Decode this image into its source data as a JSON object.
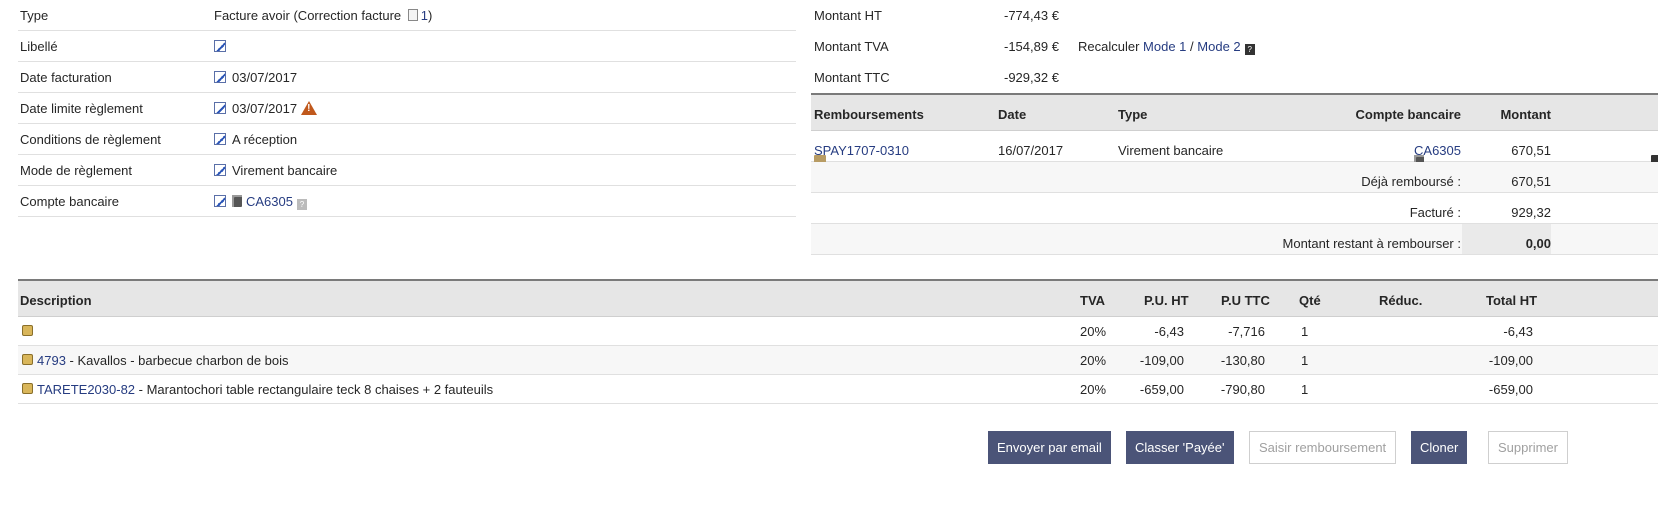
{
  "left_rows": [
    {
      "label": "Type",
      "value_pre": "Facture avoir (Correction facture ",
      "value_link": "1",
      "value_post": ")"
    },
    {
      "label": "Libellé",
      "value": ""
    },
    {
      "label": "Date facturation",
      "value": "03/07/2017"
    },
    {
      "label": "Date limite règlement",
      "value": "03/07/2017"
    },
    {
      "label": "Conditions de règlement",
      "value": "A réception"
    },
    {
      "label": "Mode de règlement",
      "value": "Virement bancaire"
    },
    {
      "label": "Compte bancaire",
      "value": "CA6305"
    }
  ],
  "summary": {
    "ht_label": "Montant HT",
    "ht_value": "-774,43 €",
    "tva_label": "Montant TVA",
    "tva_value": "-154,89 €",
    "recalc_label": "Recalculer",
    "mode1": "Mode 1",
    "sep": "/",
    "mode2": "Mode 2",
    "ttc_label": "Montant TTC",
    "ttc_value": "-929,32 €"
  },
  "payments": {
    "headers": {
      "ref": "Remboursements",
      "date": "Date",
      "type": "Type",
      "account": "Compte bancaire",
      "amount": "Montant"
    },
    "rows": [
      {
        "ref": "SPAY1707-0310",
        "date": "16/07/2017",
        "type": "Virement bancaire",
        "account": "CA6305",
        "amount": "670,51"
      }
    ],
    "deja_label": "Déjà remboursé :",
    "deja_value": "670,51",
    "facture_label": "Facturé :",
    "facture_value": "929,32",
    "reste_label": "Montant restant à rembourser :",
    "reste_value": "0,00"
  },
  "lines": {
    "headers": {
      "desc": "Description",
      "tva": "TVA",
      "puht": "P.U. HT",
      "puttc": "P.U TTC",
      "qty": "Qté",
      "reduc": "Réduc.",
      "total": "Total HT"
    },
    "rows": [
      {
        "ref": "",
        "sep": "",
        "label": "",
        "tva": "20%",
        "puht": "-6,43",
        "puttc": "-7,716",
        "qty": "1",
        "total": "-6,43"
      },
      {
        "ref": "4793",
        "sep": " - ",
        "label": "Kavallos - barbecue charbon de bois",
        "tva": "20%",
        "puht": "-109,00",
        "puttc": "-130,80",
        "qty": "1",
        "total": "-109,00"
      },
      {
        "ref": "TARETE2030-82",
        "sep": " - ",
        "label": "Marantochori table rectangulaire teck 8 chaises + 2 fauteuils",
        "tva": "20%",
        "puht": "-659,00",
        "puttc": "-790,80",
        "qty": "1",
        "total": "-659,00"
      }
    ]
  },
  "buttons": {
    "email": "Envoyer par email",
    "paid": "Classer 'Payée'",
    "refund": "Saisir remboursement",
    "clone": "Cloner",
    "delete": "Supprimer"
  },
  "colors": {
    "accent_button": "#4b5478",
    "link": "#263c81",
    "warning": "#c0581c"
  }
}
